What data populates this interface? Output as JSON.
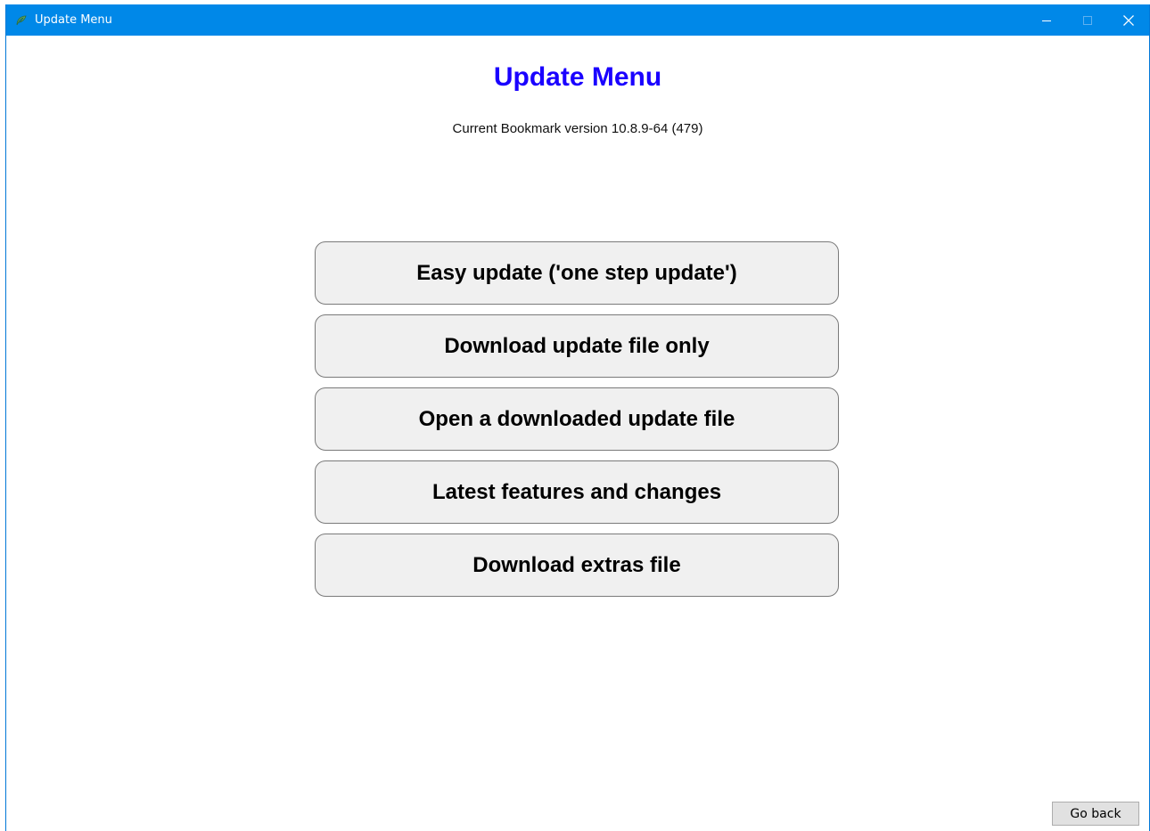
{
  "window": {
    "title": "Update Menu",
    "controls": [
      "minimize-icon",
      "maximize-icon",
      "close-icon"
    ]
  },
  "page": {
    "heading": "Update Menu",
    "version_text": "Current Bookmark version 10.8.9-64 (479)"
  },
  "menu": {
    "items": [
      {
        "label": "Easy update ('one step update')"
      },
      {
        "label": "Download update file only"
      },
      {
        "label": "Open a downloaded update file"
      },
      {
        "label": "Latest features and changes"
      },
      {
        "label": "Download extras file"
      }
    ]
  },
  "footer": {
    "back_label": "Go back"
  },
  "colors": {
    "titlebar": "#0088e8",
    "heading": "#1a00ff",
    "button_bg": "#f0f0f0"
  }
}
